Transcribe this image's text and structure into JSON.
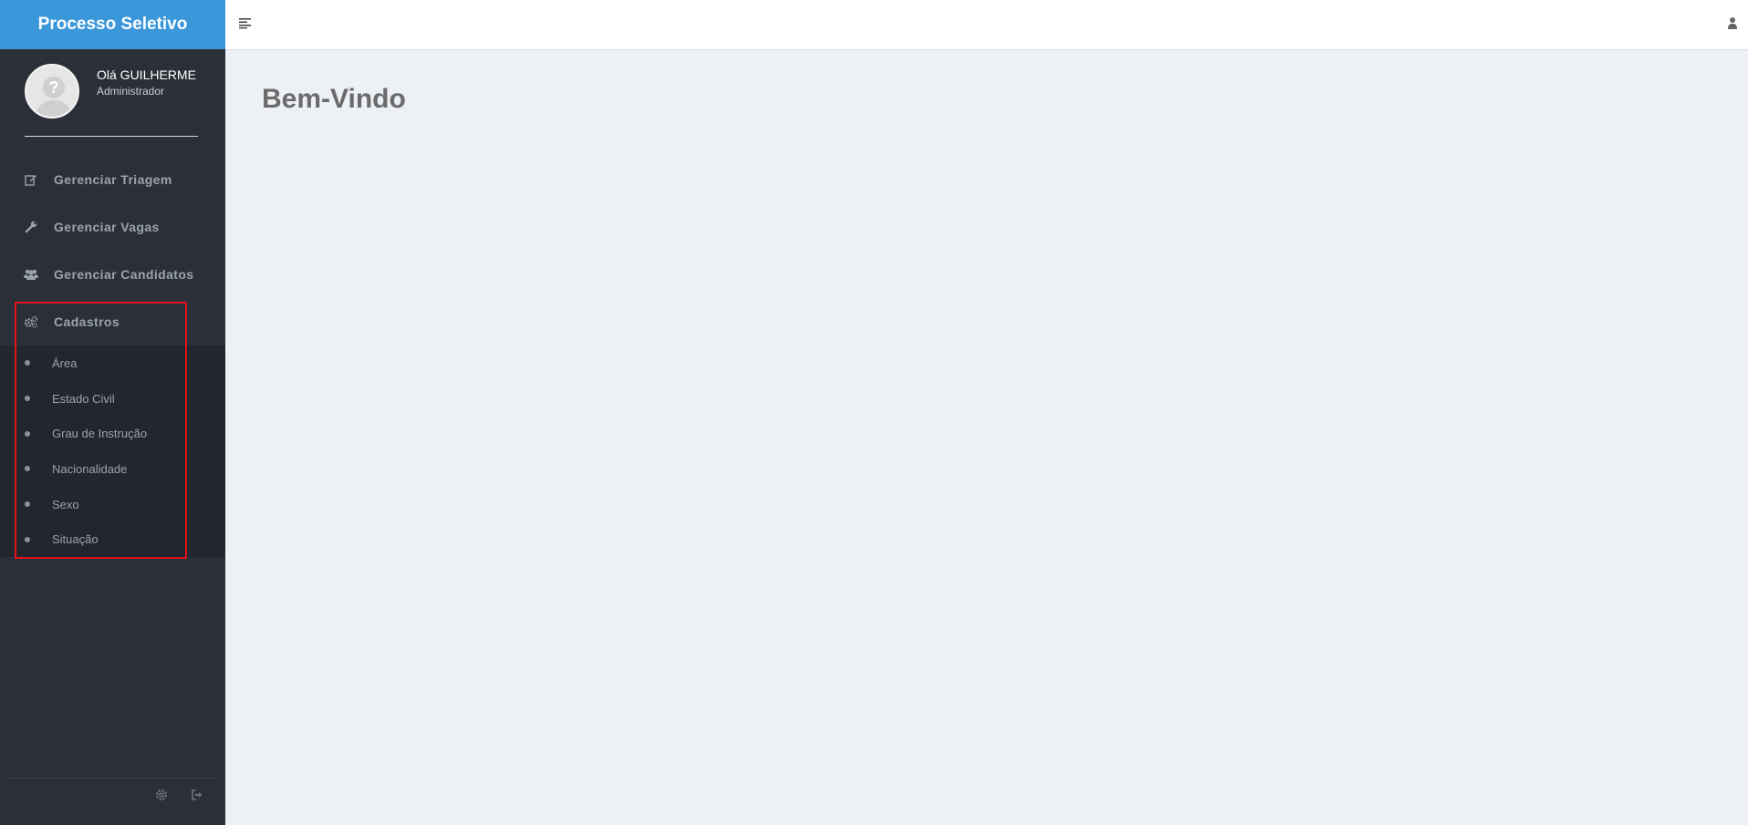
{
  "brand": {
    "title": "Processo Seletivo",
    "color": "#3a97da"
  },
  "profile": {
    "greeting": "Olá GUILHERME",
    "role": "Administrador",
    "avatar_icon": "question-avatar-icon"
  },
  "nav": {
    "items": [
      {
        "label": "Gerenciar Triagem",
        "icon": "edit-icon"
      },
      {
        "label": "Gerenciar Vagas",
        "icon": "wrench-icon"
      },
      {
        "label": "Gerenciar Candidatos",
        "icon": "users-icon"
      },
      {
        "label": "Cadastros",
        "icon": "cogs-icon",
        "expanded": true
      }
    ],
    "cadastros_subitems": [
      {
        "label": "Área"
      },
      {
        "label": "Estado Civil"
      },
      {
        "label": "Grau de Instrução"
      },
      {
        "label": "Nacionalidade"
      },
      {
        "label": "Sexo"
      },
      {
        "label": "Situação"
      }
    ]
  },
  "footer": {
    "icons": [
      "settings-icon",
      "logout-icon"
    ]
  },
  "topbar": {
    "menu_icon": "hamburger-icon",
    "user_icon": "user-icon"
  },
  "main": {
    "title": "Bem-Vindo"
  },
  "colors": {
    "sidebar": "#2b3038",
    "submenu": "#23272d",
    "highlight": "#e1121a",
    "background": "#edf0f5"
  }
}
